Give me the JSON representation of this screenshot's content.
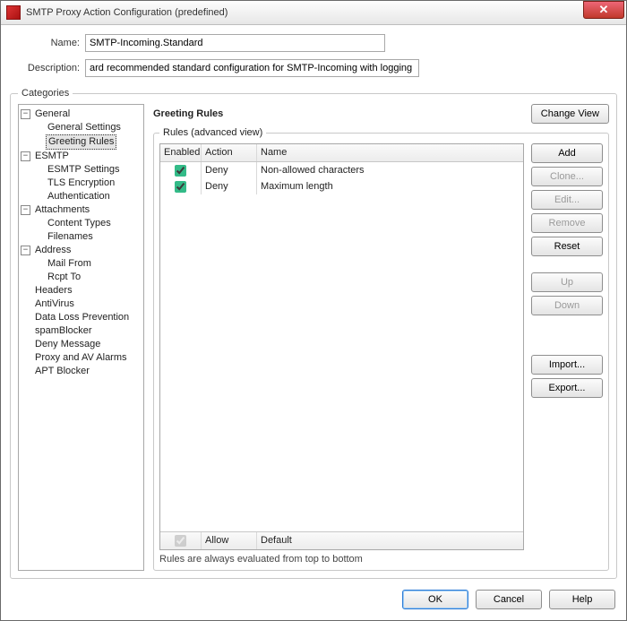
{
  "titlebar": {
    "title": "SMTP Proxy Action Configuration (predefined)"
  },
  "form": {
    "name_label": "Name:",
    "name_value": "SMTP-Incoming.Standard",
    "desc_label": "Description:",
    "desc_value": "ard recommended standard configuration for SMTP-Incoming with logging enabled"
  },
  "categories": {
    "legend": "Categories",
    "tree": [
      {
        "label": "General",
        "level": 1,
        "expandable": true,
        "expanded": true,
        "name": "tree-general"
      },
      {
        "label": "General Settings",
        "level": 2,
        "name": "tree-general-settings"
      },
      {
        "label": "Greeting Rules",
        "level": 2,
        "selected": true,
        "name": "tree-greeting-rules"
      },
      {
        "label": "ESMTP",
        "level": 1,
        "expandable": true,
        "expanded": true,
        "name": "tree-esmtp"
      },
      {
        "label": "ESMTP Settings",
        "level": 2,
        "name": "tree-esmtp-settings"
      },
      {
        "label": "TLS Encryption",
        "level": 2,
        "name": "tree-tls-encryption"
      },
      {
        "label": "Authentication",
        "level": 2,
        "name": "tree-authentication"
      },
      {
        "label": "Attachments",
        "level": 1,
        "expandable": true,
        "expanded": true,
        "name": "tree-attachments"
      },
      {
        "label": "Content Types",
        "level": 2,
        "name": "tree-content-types"
      },
      {
        "label": "Filenames",
        "level": 2,
        "name": "tree-filenames"
      },
      {
        "label": "Address",
        "level": 1,
        "expandable": true,
        "expanded": true,
        "name": "tree-address"
      },
      {
        "label": "Mail From",
        "level": 2,
        "name": "tree-mail-from"
      },
      {
        "label": "Rcpt To",
        "level": 2,
        "name": "tree-rcpt-to"
      },
      {
        "label": "Headers",
        "level": 1,
        "name": "tree-headers"
      },
      {
        "label": "AntiVirus",
        "level": 1,
        "name": "tree-antivirus"
      },
      {
        "label": "Data Loss Prevention",
        "level": 1,
        "name": "tree-dlp"
      },
      {
        "label": "spamBlocker",
        "level": 1,
        "name": "tree-spamblocker"
      },
      {
        "label": "Deny Message",
        "level": 1,
        "name": "tree-deny-message"
      },
      {
        "label": "Proxy and AV Alarms",
        "level": 1,
        "name": "tree-proxy-av-alarms"
      },
      {
        "label": "APT Blocker",
        "level": 1,
        "name": "tree-apt-blocker"
      }
    ]
  },
  "panel": {
    "heading": "Greeting Rules",
    "change_view": "Change View",
    "rules_legend": "Rules (advanced view)",
    "columns": {
      "enabled": "Enabled",
      "action": "Action",
      "name": "Name"
    },
    "rows": [
      {
        "enabled": true,
        "action": "Deny",
        "name": "Non-allowed characters"
      },
      {
        "enabled": true,
        "action": "Deny",
        "name": "Maximum length"
      }
    ],
    "default_row": {
      "enabled": true,
      "enabled_disabled": true,
      "action": "Allow",
      "name": "Default"
    },
    "hint": "Rules are always evaluated from top to bottom",
    "buttons": {
      "add": "Add",
      "clone": "Clone...",
      "edit": "Edit...",
      "remove": "Remove",
      "reset": "Reset",
      "up": "Up",
      "down": "Down",
      "import": "Import...",
      "export": "Export..."
    },
    "disabled": {
      "clone": true,
      "edit": true,
      "remove": true,
      "up": true,
      "down": true
    }
  },
  "footer": {
    "ok": "OK",
    "cancel": "Cancel",
    "help": "Help"
  }
}
